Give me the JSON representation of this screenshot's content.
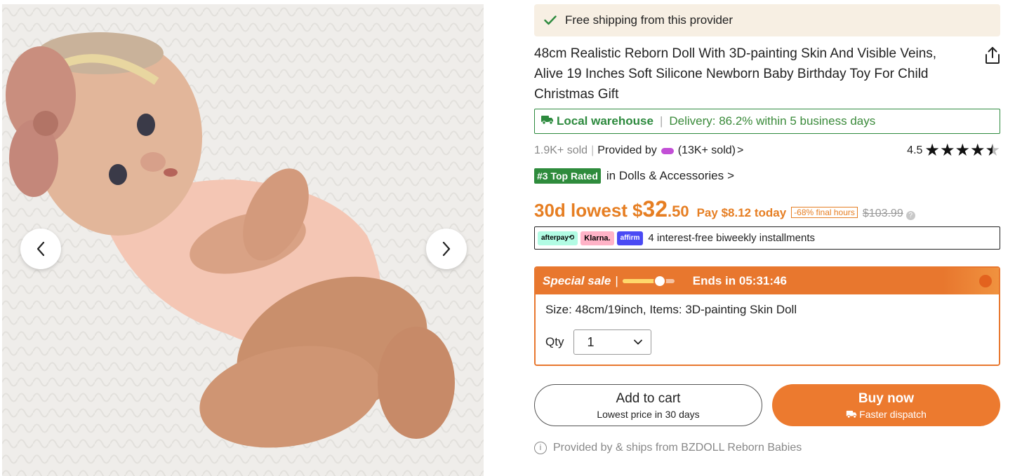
{
  "shipping": {
    "text": "Free shipping from this provider"
  },
  "product": {
    "title": "48cm Realistic Reborn Doll With 3D-painting Skin And Visible Veins, Alive 19 Inches Soft Silicone Newborn Baby Birthday Toy For Child Christmas Gift"
  },
  "warehouse": {
    "label": "Local warehouse",
    "separator": "|",
    "delivery": "Delivery: 86.2% within 5 business days"
  },
  "meta": {
    "sold": "1.9K+ sold",
    "separator": "|",
    "provided_by": "Provided by",
    "seller_sold": "(13K+ sold)",
    "chevron": ">",
    "rating": "4.5",
    "rating_value": 4.5,
    "stars_max": 5
  },
  "rank": {
    "badge": "#3 Top Rated",
    "category": "in Dolls & Accessories",
    "chevron": ">"
  },
  "price": {
    "lowest_label": "30d lowest",
    "currency": "$",
    "integer": "32",
    "cents": ".50",
    "pay_today": "Pay $8.12 today",
    "discount": "-68% final hours",
    "original": "$103.99",
    "help": "?"
  },
  "installments": {
    "afterpay": "afterpay⟲",
    "klarna": "Klarna.",
    "affirm": "affirm",
    "text": "4 interest-free biweekly installments"
  },
  "sale": {
    "label": "Special sale",
    "separator": "|",
    "progress_fraction": 0.72,
    "ends": "Ends in 05:31:46",
    "size_line": "Size: 48cm/19inch, Items: 3D-painting Skin Doll",
    "qty_label": "Qty",
    "qty_value": "1"
  },
  "buttons": {
    "add_to_cart": "Add to cart",
    "add_to_cart_sub": "Lowest price in 30 days",
    "buy_now": "Buy now",
    "buy_now_sub": "Faster dispatch"
  },
  "footer": {
    "info": "i",
    "provided_line": "Provided by & ships from BZDOLL Reborn Babies"
  },
  "icons": {
    "check": "check-icon",
    "share": "share-icon",
    "truck": "truck-icon",
    "star": "star-icon",
    "prev": "chevron-left-icon",
    "next": "chevron-right-icon",
    "dropdown": "chevron-down-icon"
  },
  "colors": {
    "accent_orange": "#e8772e",
    "green": "#2d8a3e",
    "banner_bg": "#f7efe3"
  }
}
